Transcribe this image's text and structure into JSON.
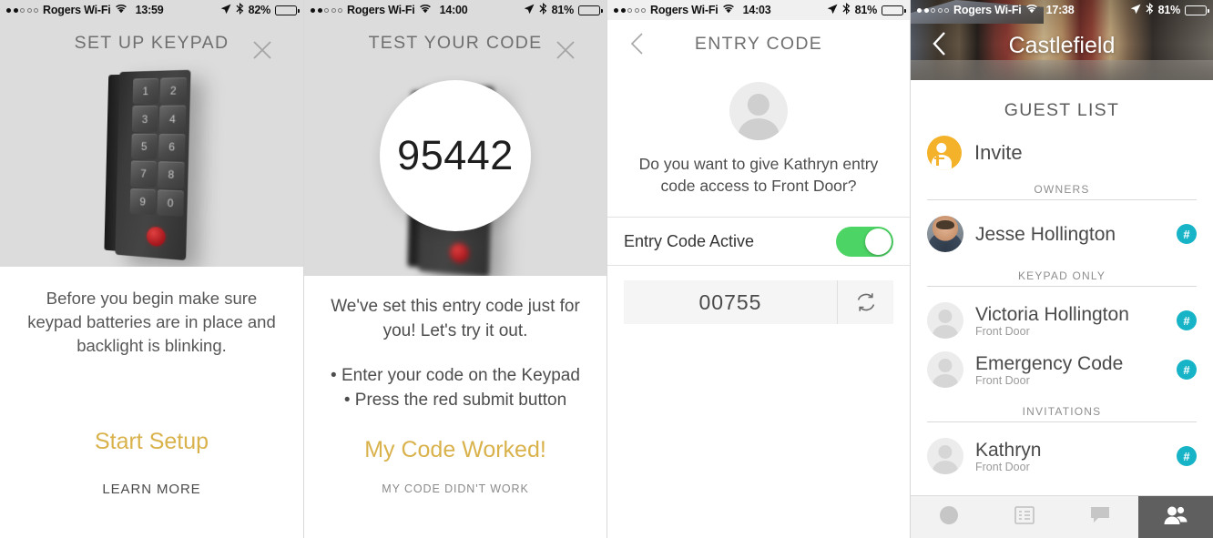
{
  "panels": [
    {
      "status": {
        "carrier": "Rogers Wi-Fi",
        "time": "13:59",
        "battery": "82%",
        "signal_dots": 2
      },
      "title": "SET UP KEYPAD",
      "close_icon": "close-icon",
      "device": {
        "keys": [
          "1",
          "2",
          "3",
          "4",
          "5",
          "6",
          "7",
          "8",
          "9",
          "0"
        ],
        "submit_color": "#a3161c"
      },
      "instruction": "Before you begin make sure keypad batteries are in place and backlight is blinking.",
      "primary_cta": "Start Setup",
      "secondary_cta": "LEARN MORE",
      "accent_color": "#d9b24c"
    },
    {
      "status": {
        "carrier": "Rogers Wi-Fi",
        "time": "14:00",
        "battery": "81%",
        "signal_dots": 2
      },
      "title": "TEST YOUR CODE",
      "close_icon": "close-icon",
      "code": "95442",
      "intro": "We've set this entry code just for you! Let's try it out.",
      "steps": [
        "• Enter your code on the Keypad",
        "• Press the red submit button"
      ],
      "primary_cta": "My Code Worked!",
      "secondary_cta": "MY CODE DIDN'T WORK",
      "accent_color": "#d9b24c"
    },
    {
      "status": {
        "carrier": "Rogers Wi-Fi",
        "time": "14:03",
        "battery": "81%",
        "signal_dots": 2
      },
      "title": "ENTRY CODE",
      "back_icon": "chevron-left-icon",
      "avatar_icon": "person-placeholder-icon",
      "question": "Do you want to give Kathryn entry code access to Front Door?",
      "toggle_label": "Entry Code Active",
      "toggle_on": true,
      "toggle_color": "#4cd464",
      "code_value": "00755",
      "refresh_icon": "refresh-icon"
    },
    {
      "status": {
        "carrier": "Rogers Wi-Fi",
        "time": "17:38",
        "battery": "81%",
        "signal_dots": 2
      },
      "home_name": "Castlefield",
      "back_icon": "chevron-left-icon",
      "list_title": "GUEST LIST",
      "invite": {
        "label": "Invite",
        "icon": "add-person-icon",
        "color": "#f3b229"
      },
      "sections": [
        {
          "header": "OWNERS",
          "rows": [
            {
              "name": "Jesse Hollington",
              "sub": "",
              "avatar": "photo",
              "badge": "#"
            }
          ]
        },
        {
          "header": "KEYPAD ONLY",
          "rows": [
            {
              "name": "Victoria Hollington",
              "sub": "Front Door",
              "avatar": "placeholder",
              "badge": "#"
            },
            {
              "name": "Emergency Code",
              "sub": "Front Door",
              "avatar": "placeholder",
              "badge": "#"
            }
          ]
        },
        {
          "header": "INVITATIONS",
          "rows": [
            {
              "name": "Kathryn",
              "sub": "Front Door",
              "avatar": "placeholder",
              "badge": "#"
            }
          ]
        }
      ],
      "badge_color": "#17b4c8",
      "tabs": [
        {
          "icon": "circle-icon",
          "active": false
        },
        {
          "icon": "list-icon",
          "active": false
        },
        {
          "icon": "chat-bubble-icon",
          "active": false
        },
        {
          "icon": "people-icon",
          "active": true
        }
      ]
    }
  ]
}
